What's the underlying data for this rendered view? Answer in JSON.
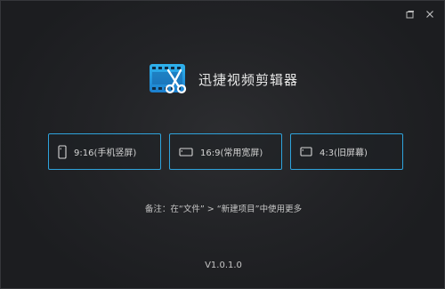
{
  "app": {
    "title": "迅捷视频剪辑器",
    "version": "V1.0.1.0",
    "icon": "film-scissors-icon"
  },
  "window_controls": {
    "restore_icon": "restore-icon",
    "close_icon": "close-icon"
  },
  "aspect_ratios": [
    {
      "label": "9:16(手机竖屏)",
      "icon": "phone-portrait-icon"
    },
    {
      "label": "16:9(常用宽屏)",
      "icon": "widescreen-icon"
    },
    {
      "label": "4:3(旧屏幕)",
      "icon": "old-screen-icon"
    }
  ],
  "hint": "备注：在“文件” > “新建项目”中使用更多",
  "colors": {
    "accent": "#2ea3dc",
    "background": "#222326",
    "text": "#d4d4d4"
  }
}
